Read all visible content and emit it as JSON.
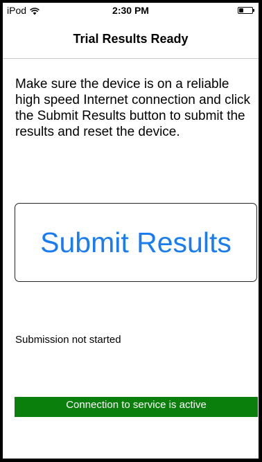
{
  "status_bar": {
    "carrier": "iPod",
    "time": "2:30 PM"
  },
  "nav": {
    "title": "Trial Results Ready"
  },
  "main": {
    "instructions": "Make sure the device is on a reliable high speed Internet connection and click the Submit Results button to submit the results and reset the device.",
    "submit_label": "Submit Results",
    "submission_status": "Submission not started",
    "connection_status": "Connection to service is active"
  },
  "colors": {
    "accent": "#1a7cf0",
    "connection_active": "#0b7f0b"
  }
}
